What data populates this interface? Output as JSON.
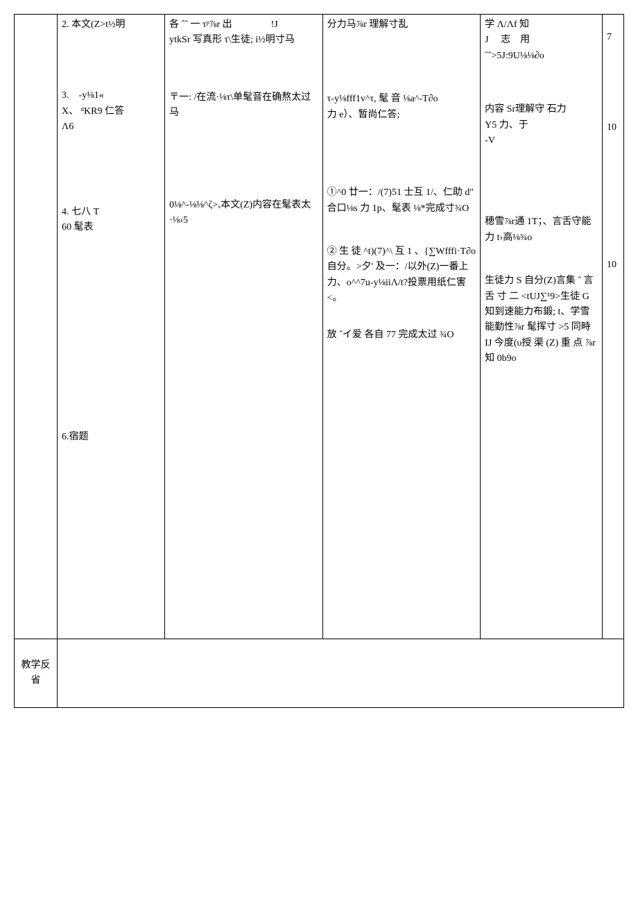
{
  "rows": [
    {
      "c2_a": "2. 本文(Z>t½明",
      "c2_b": "3.　-y⅛1«\nX、 ᵈKR9 仁答\nΛ6",
      "c2_c": "4. 七八 T\n60 髦表",
      "c2_d": "6.宿题",
      "c3_a": "各 ˆˆ 一 τᵖ⅞r 出　　　　!J\nytkSr 写真形 τ\\生徒; i½明寸马",
      "c3_b": "〒一: /在流·⅛τ\\单髦音在确熬太过马",
      "c3_c": "0⅛^-⅛⅛^ζ>ₓ本文(Z)内容在髦表太·⅛›5",
      "c4_a": "分力马⅞r 理解寸乱",
      "c4_b": "τ-y⅛fff1v^τ, 髦 音 ⅛a^-T∂o\n力 e）、暂尚仁答;",
      "c4_c": "①^0 廿一：/(7)51 士互 1/、仁助 d″合口⅛s 力 1p、髦表 ⅛*完成寸¾O",
      "c4_d": "② 生 徒 ^t)(7)^\\ 互 1 、{∑Wfffi·T∂o 自分。>夕' 及一：/以外(Z)一番上力、o^^7u-y⅛iiΛ/t?投票用纸仁害<。",
      "c4_e": "放 ˆイ爱 各自 77 完成太过 ¾O",
      "c5_a": "学 Λ/Λf 知\nJ　 志　用\nˆˆ>5J:9U⅛⅛∂o",
      "c5_b": "内容 Sr理解守 石力\nY5 力、于\n-V",
      "c5_c": "穂雪⅞r通 1T；、言舌守能力 t›高⅛¾o",
      "c5_d": "生徒力 S 自分(Z)言集 ˆ 言 舌 寸 二 <tUJ∑¹9>生徒 G 知到速能力布鍛; t、学雪能勤性⅞r 髦挥寸 >5 同畤 IJ 今度(υ授 渠 (Z) 重 点 ⅞r 知 0b9o",
      "c6_a": "7",
      "c6_b": "10",
      "c6_c": "10"
    }
  ],
  "reflect_label": "教学反省"
}
